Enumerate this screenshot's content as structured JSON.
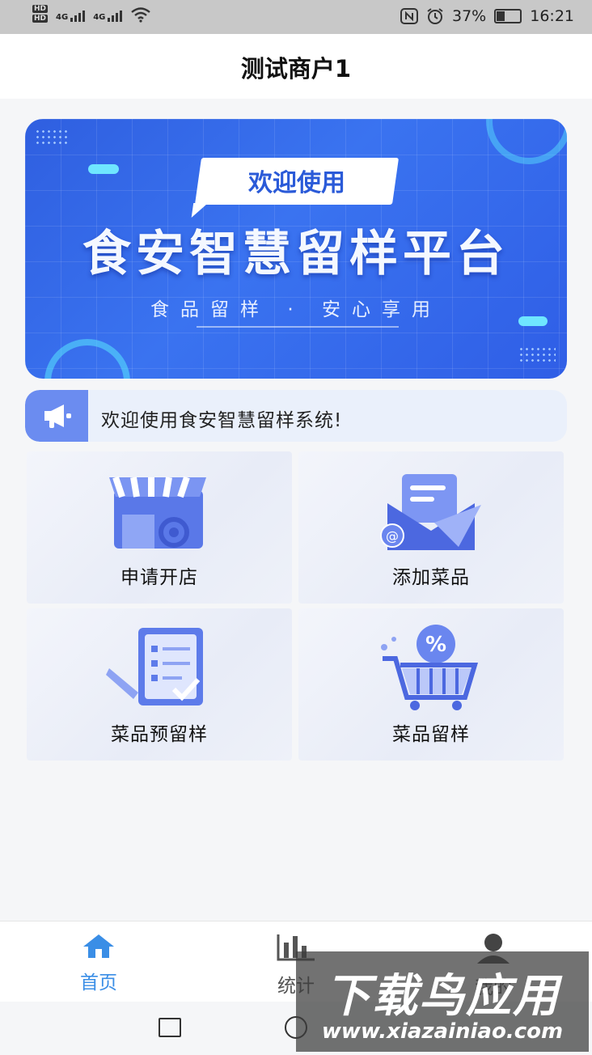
{
  "status_bar": {
    "hd1": "HD",
    "hd2": "HD",
    "net1": "4G",
    "net2": "4G",
    "battery_percent": "37%",
    "battery_level": 0.37,
    "time": "16:21"
  },
  "header": {
    "title": "测试商户1"
  },
  "banner": {
    "welcome": "欢迎使用",
    "platform": "食安智慧留样平台",
    "slogan": "食品留样 · 安心享用"
  },
  "notice": {
    "text": "欢迎使用食安智慧留样系统!"
  },
  "menu": {
    "items": [
      {
        "label": "申请开店"
      },
      {
        "label": "添加菜品"
      },
      {
        "label": "菜品预留样"
      },
      {
        "label": "菜品留样"
      }
    ]
  },
  "tabbar": {
    "tabs": [
      {
        "label": "首页",
        "active": true
      },
      {
        "label": "统计"
      },
      {
        "label": "我的"
      }
    ],
    "active_color": "#3a8ee6"
  },
  "watermark": {
    "title": "下载鸟应用",
    "url": "www.xiazainiao.com"
  },
  "colors": {
    "banner_blue": "#3a73f0",
    "accent": "#6b8cf0"
  }
}
